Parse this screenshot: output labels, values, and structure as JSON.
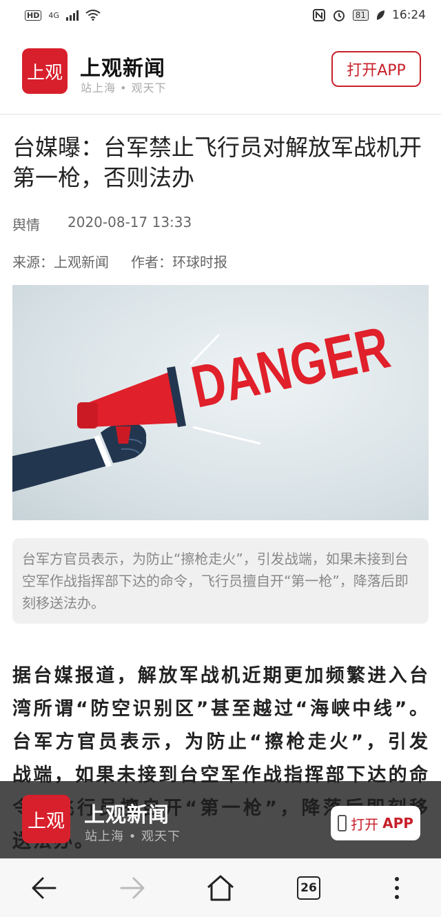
{
  "status_bar": {
    "hd": "HD",
    "network": "4G",
    "battery": "81",
    "time": "16:24"
  },
  "header": {
    "logo_text": "上观",
    "brand_name": "上观新闻",
    "slogan": "站上海 • 观天下",
    "open_app_label": "打开APP"
  },
  "article": {
    "title": "台媒曝：台军禁止飞行员对解放军战机开第一枪，否则法办",
    "category": "舆情",
    "date": "2020-08-17 13:33",
    "source": "来源：上观新闻",
    "author": "作者：环球时报",
    "image_text": "DANGER",
    "caption": "台军方官员表示，为防止“擦枪走火”，引发战端，如果未接到台空军作战指挥部下达的命令，飞行员擅自开“第一枪”，降落后即刻移送法办。",
    "body": "据台媒报道，解放军战机近期更加频繁进入台湾所谓“防空识别区”甚至越过“海峡中线”。台军方官员表示，为防止“擦枪走火”，引发战端，如果未接到台空军作战指挥部下达的命令，飞行员擅自开“第一枪”，降落后即刻移送法办。"
  },
  "float_banner": {
    "logo_text": "上观",
    "brand_name": "上观新闻",
    "slogan": "站上海 • 观天下",
    "btn_prefix": "打开",
    "btn_suffix": "APP"
  },
  "navbar": {
    "tab_count": "26",
    "icons": [
      "back-icon",
      "forward-icon",
      "home-icon",
      "tabs-icon",
      "more-icon"
    ]
  },
  "colors": {
    "brand_red": "#d8202c",
    "accent": "#c8202a"
  }
}
